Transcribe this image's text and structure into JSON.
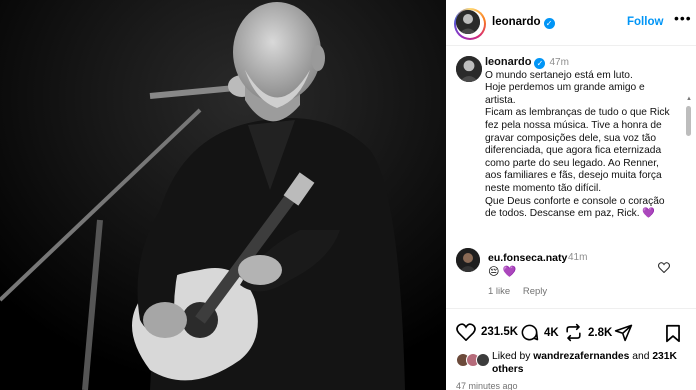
{
  "post": {
    "author": "leonardo",
    "follow_label": "Follow",
    "more_label": "•••",
    "caption": {
      "username": "leonardo",
      "time": "47m",
      "lines": [
        "O mundo sertanejo está em luto.",
        "Hoje perdemos um grande amigo e",
        "artista.",
        "Ficam as lembranças de tudo o que Rick",
        "fez pela nossa música. Tive a honra de",
        "gravar composições dele, sua voz tão",
        "diferenciada, que agora fica eternizada",
        "como parte do seu legado. Ao Renner,",
        "aos familiares e fãs, desejo muita força",
        "neste momento tão difícil.",
        "Que Deus conforte e console o coração",
        "de todos. Descanse em paz, Rick. 💜"
      ]
    },
    "comment": {
      "username": "eu.fonseca.naty",
      "time": "41m",
      "text": "😔 💜",
      "likes": "1 like",
      "reply": "Reply"
    },
    "actions": {
      "like_count": "231.5K",
      "comment_count": "4K",
      "share_count": "2.8K"
    },
    "liked_by": {
      "prefix": "Liked by",
      "user": "wandrezafernandes",
      "and": "and",
      "count": "231K",
      "suffix": "others"
    },
    "time_ago": "47 minutes ago"
  },
  "icons": {
    "verified": "verified-badge-icon",
    "heart": "heart-icon",
    "comment": "comment-icon",
    "repost": "repost-icon",
    "share": "share-icon",
    "bookmark": "bookmark-icon"
  },
  "colors": {
    "accent": "#0095f6",
    "muted": "#8e8e8e",
    "emoji_purple": "#6a3fb5"
  }
}
